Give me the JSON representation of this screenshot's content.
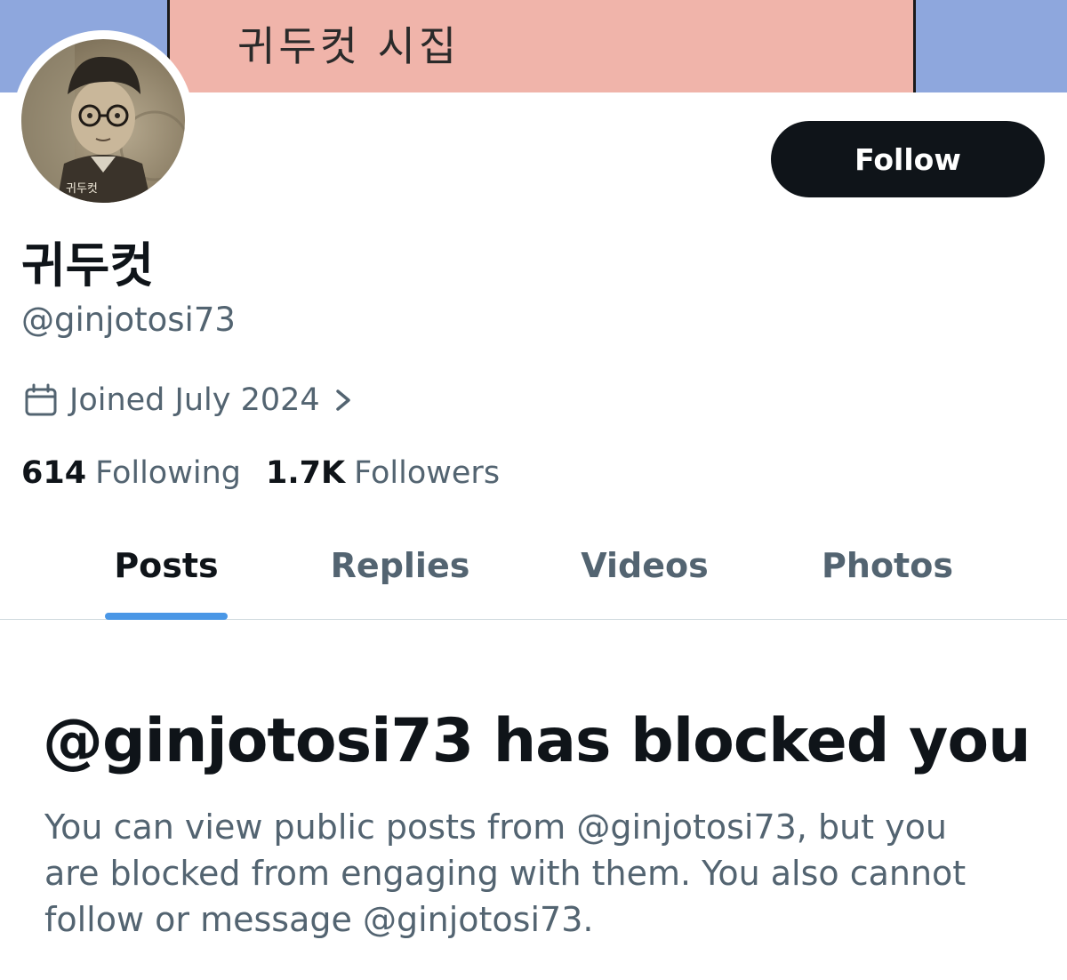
{
  "banner": {
    "text": "귀두컷 시집"
  },
  "avatar": {
    "caption": "귀두컷"
  },
  "profile": {
    "display_name": "귀두컷",
    "handle": "@ginjotosi73",
    "joined": "Joined July 2024",
    "following_count": "614",
    "following_label": "Following",
    "followers_count": "1.7K",
    "followers_label": "Followers"
  },
  "follow_button": {
    "label": "Follow"
  },
  "tabs": [
    {
      "label": "Posts",
      "active": true
    },
    {
      "label": "Replies",
      "active": false
    },
    {
      "label": "Videos",
      "active": false
    },
    {
      "label": "Photos",
      "active": false
    }
  ],
  "blocked": {
    "title": "@ginjotosi73 has blocked you",
    "body": "You can view public posts from @ginjotosi73, but you are blocked from engaging with them. You also cannot follow or message @ginjotosi73."
  },
  "colors": {
    "banner_bg": "#8ea7dd",
    "banner_card": "#f0b4aa",
    "accent": "#4a97e6",
    "primary_text": "#0f1419",
    "secondary_text": "#536471"
  },
  "icons": {
    "calendar": "calendar-icon",
    "chevron": "chevron-right-icon"
  }
}
